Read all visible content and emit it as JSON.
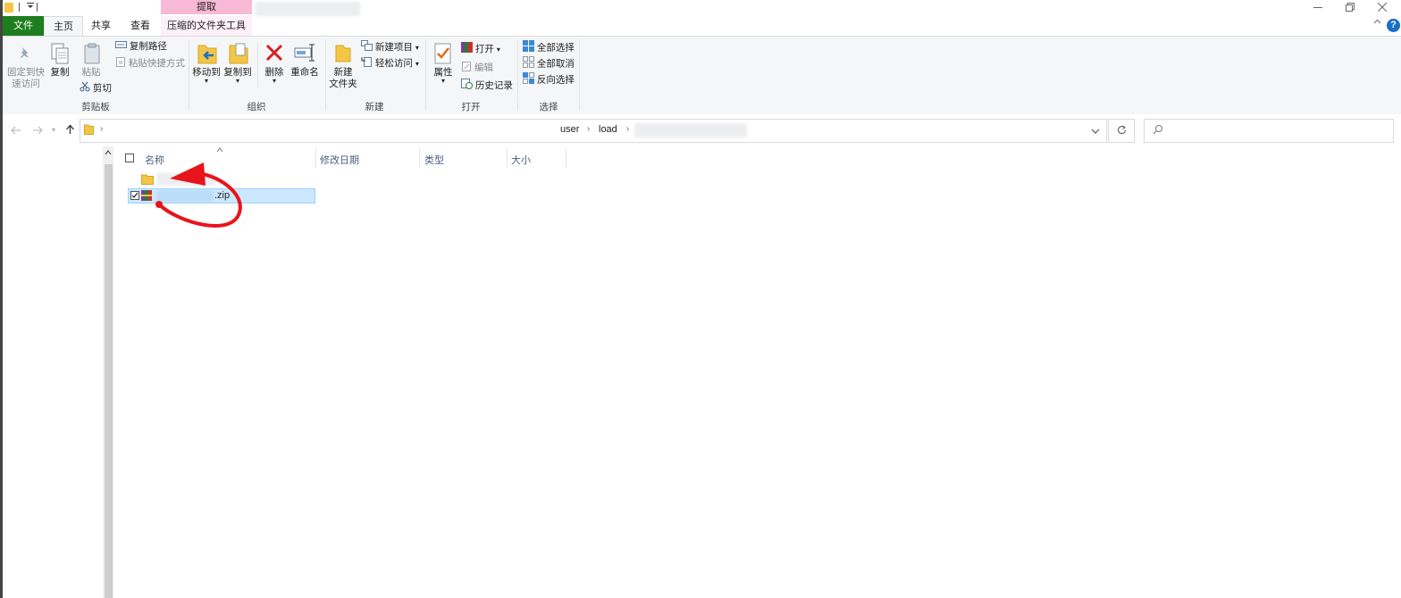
{
  "window": {
    "minimize_icon": "minimize-icon",
    "restore_icon": "restore-icon",
    "close_icon": "close-icon"
  },
  "tabs": {
    "file": "文件",
    "home": "主页",
    "share": "共享",
    "view": "查看",
    "context_group": "提取",
    "context_tab": "压缩的文件夹工具"
  },
  "ribbon": {
    "clipboard": {
      "pin_line1": "固定到快",
      "pin_line2": "速访问",
      "copy": "复制",
      "paste": "粘贴",
      "copy_path": "复制路径",
      "paste_shortcut": "粘贴快捷方式",
      "cut": "剪切",
      "label": "剪贴板"
    },
    "organize": {
      "move_to": "移动到",
      "copy_to": "复制到",
      "delete": "删除",
      "rename": "重命名",
      "label": "组织"
    },
    "new": {
      "new_folder_line1": "新建",
      "new_folder_line2": "文件夹",
      "new_item": "新建项目",
      "easy_access": "轻松访问",
      "label": "新建"
    },
    "open": {
      "properties": "属性",
      "open": "打开",
      "edit": "编辑",
      "history": "历史记录",
      "label": "打开"
    },
    "select": {
      "select_all": "全部选择",
      "select_none": "全部取消",
      "invert": "反向选择",
      "label": "选择"
    }
  },
  "address": {
    "crumbs": [
      "user",
      "load"
    ]
  },
  "columns": {
    "name": "名称",
    "date": "修改日期",
    "type": "类型",
    "size": "大小"
  },
  "files": [
    {
      "kind": "folder",
      "name": ""
    },
    {
      "kind": "zip",
      "name": ".zip",
      "selected": true
    }
  ],
  "colors": {
    "file_tab": "#1e7d1e",
    "context_tab": "#f7b9d5",
    "selection": "#cce8ff",
    "annotation": "#e8141b"
  }
}
